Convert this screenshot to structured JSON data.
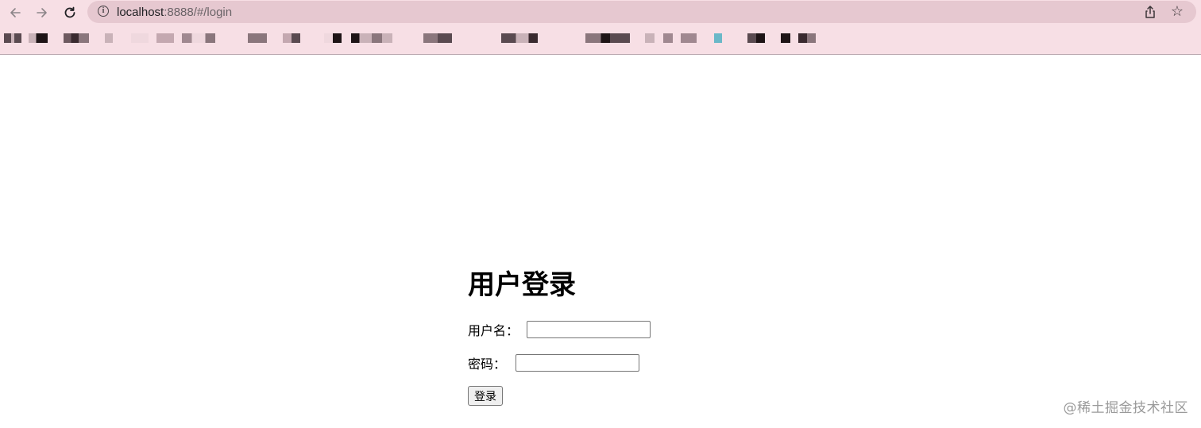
{
  "browser": {
    "url_host": "localhost",
    "url_rest": ":8888/#/login",
    "nav": {
      "back_icon": "arrow-left-icon",
      "forward_icon": "arrow-right-icon",
      "reload_icon": "reload-icon",
      "info_icon": "info-icon",
      "share_icon": "share-icon",
      "bookmark_icon": "star-icon"
    },
    "colors": {
      "toolbar_bg": "#f7dfe5",
      "omnibox_bg": "#e6c8d0"
    }
  },
  "login": {
    "title": "用户登录",
    "username_label": "用户名：",
    "password_label": "密码：",
    "username_value": "",
    "password_value": "",
    "submit_label": "登录"
  },
  "watermark": "@稀土掘金技术社区"
}
